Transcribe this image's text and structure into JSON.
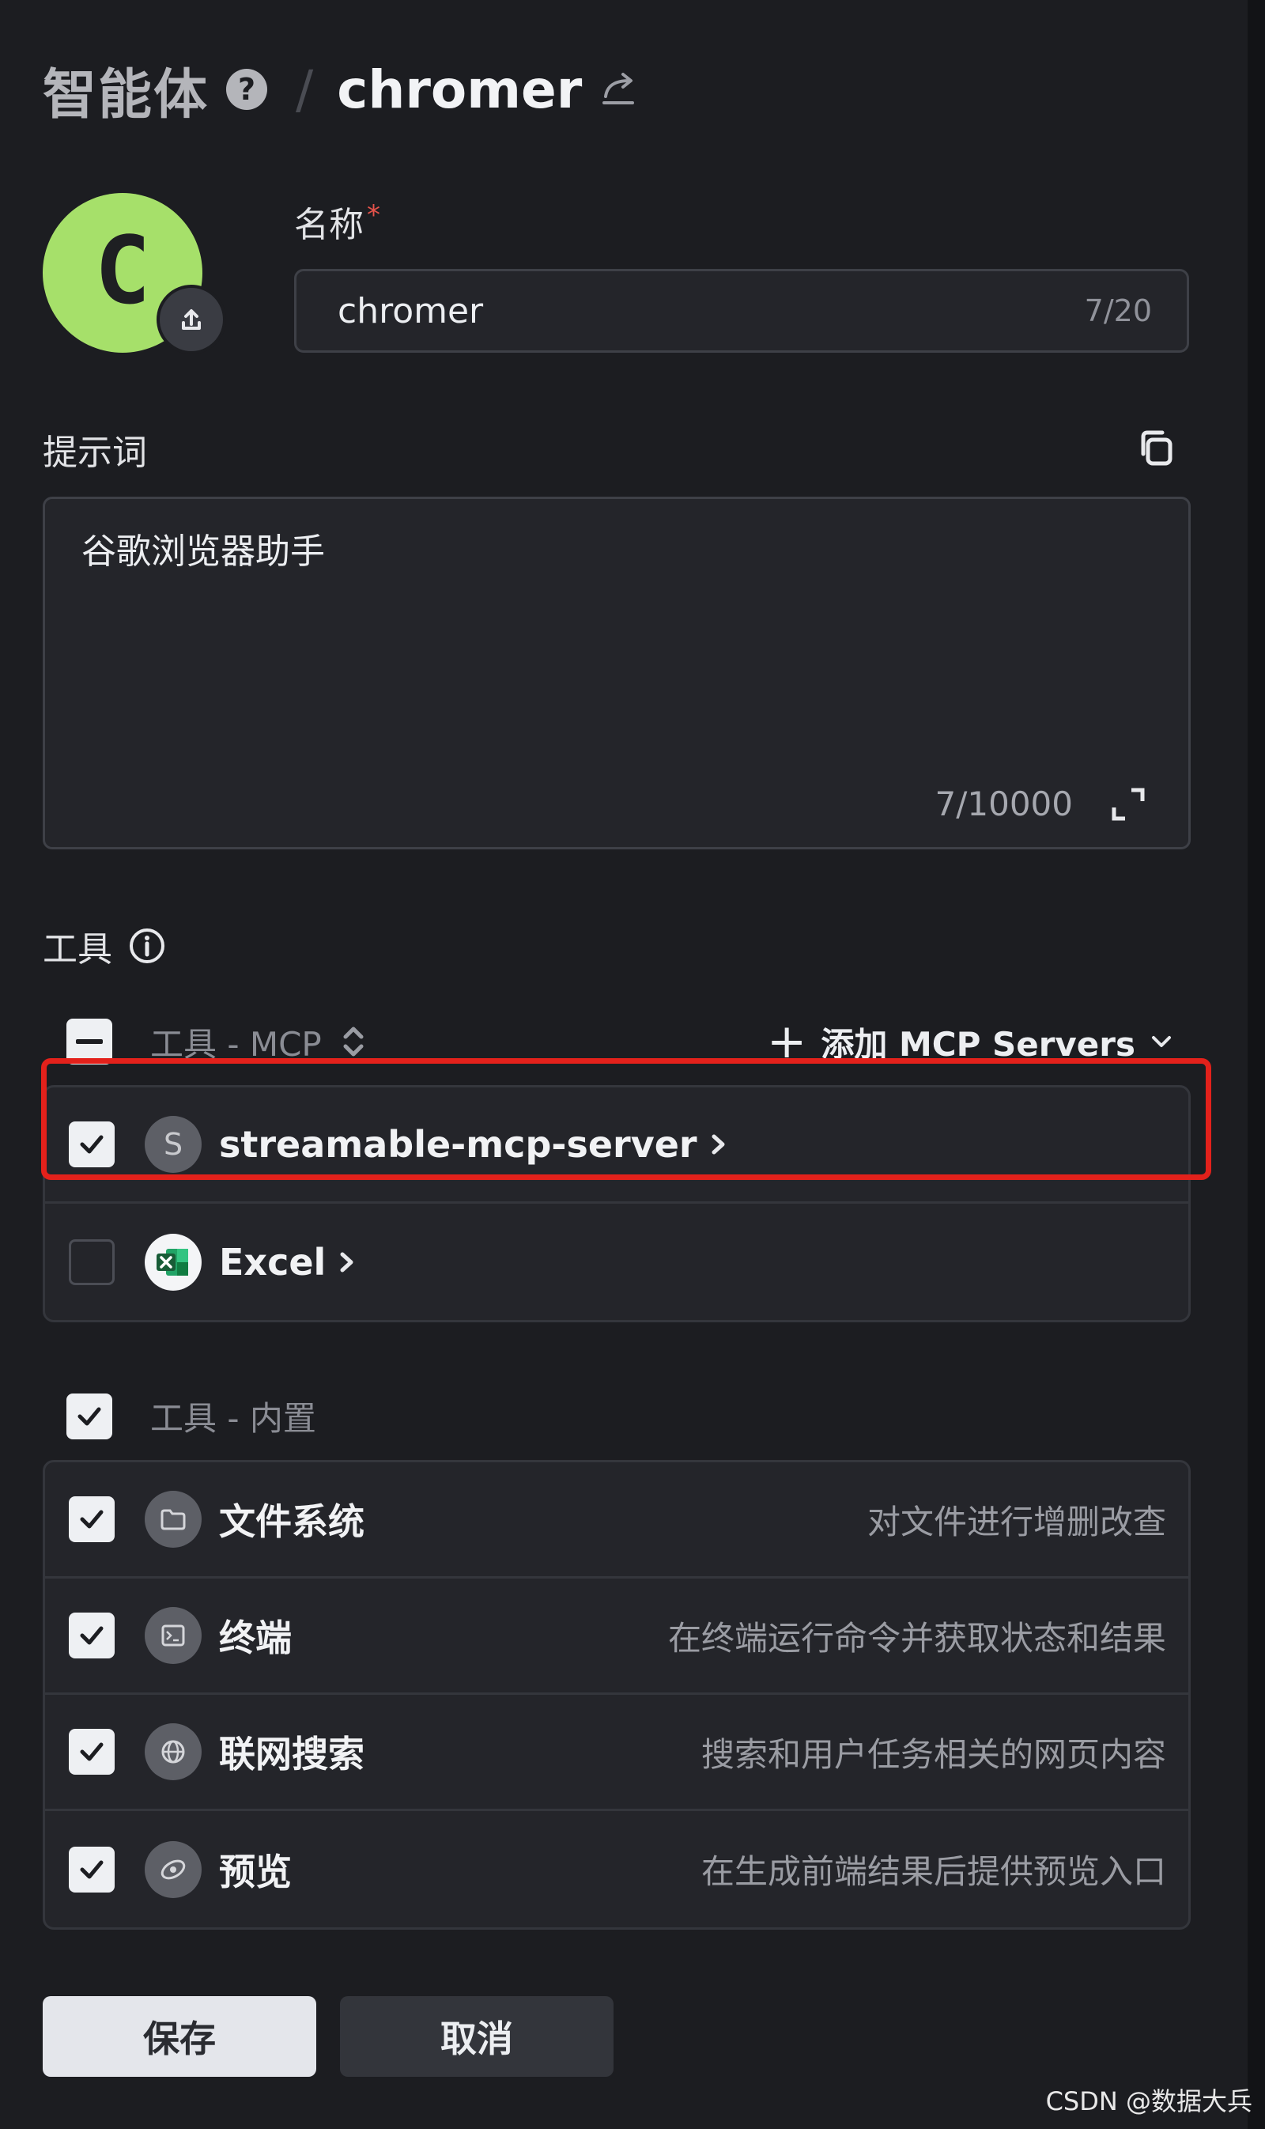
{
  "header": {
    "section_title": "智能体",
    "separator": "/",
    "agent_name": "chromer"
  },
  "avatar": {
    "letter": "C",
    "color": "#a6e06a"
  },
  "name_field": {
    "label": "名称",
    "required_mark": "*",
    "value": "chromer",
    "counter": "7/20"
  },
  "prompt": {
    "label": "提示词",
    "value": "谷歌浏览器助手",
    "counter": "7/10000"
  },
  "tools": {
    "label": "工具",
    "mcp_group": {
      "label": "工具 - MCP",
      "add_button": "添加 MCP Servers",
      "items": [
        {
          "name": "streamable-mcp-server",
          "icon_letter": "S",
          "checked": true
        },
        {
          "name": "Excel",
          "checked": false
        }
      ]
    },
    "builtin_group": {
      "label": "工具 - 内置",
      "items": [
        {
          "name": "文件系统",
          "desc": "对文件进行增删改查",
          "icon": "folder-icon"
        },
        {
          "name": "终端",
          "desc": "在终端运行命令并获取状态和结果",
          "icon": "terminal-icon"
        },
        {
          "name": "联网搜索",
          "desc": "搜索和用户任务相关的网页内容",
          "icon": "globe-icon"
        },
        {
          "name": "预览",
          "desc": "在生成前端结果后提供预览入口",
          "icon": "preview-icon"
        }
      ]
    }
  },
  "actions": {
    "save": "保存",
    "cancel": "取消"
  },
  "watermark": "CSDN @数据大兵",
  "colors": {
    "background": "#1c1d21",
    "field": "#24252a",
    "highlight": "#e3211b",
    "excel": "#1f7a45"
  }
}
